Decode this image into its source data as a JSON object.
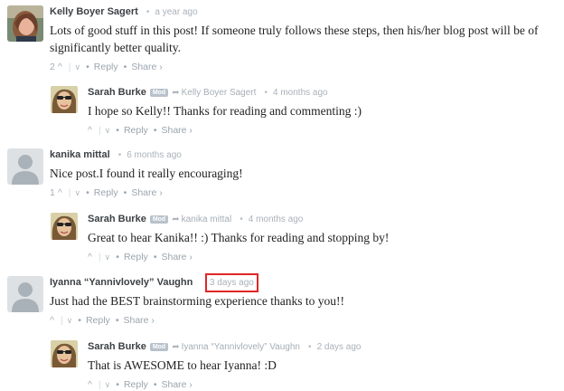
{
  "comments": [
    {
      "author": "Kelly Boyer Sagert",
      "time": "a year ago",
      "text": "Lots of good stuff in this post! If someone truly follows these steps, then his/her blog post will be of significantly better quality.",
      "votes": "2",
      "reply_label": "Reply",
      "share_label": "Share ›"
    },
    {
      "author": "Sarah Burke",
      "badge": "Mod",
      "in_reply_to": "Kelly Boyer Sagert",
      "time": "4 months ago",
      "text": "I hope so Kelly!! Thanks for reading and commenting :)",
      "reply_label": "Reply",
      "share_label": "Share ›"
    },
    {
      "author": "kanika mittal",
      "time": "6 months ago",
      "text": "Nice post.I found it really encouraging!",
      "votes": "1",
      "reply_label": "Reply",
      "share_label": "Share ›"
    },
    {
      "author": "Sarah Burke",
      "badge": "Mod",
      "in_reply_to": "kanika mittal",
      "time": "4 months ago",
      "text": "Great to hear Kanika!! :) Thanks for reading and stopping by!",
      "reply_label": "Reply",
      "share_label": "Share ›"
    },
    {
      "author": "Iyanna “Yannivlovely” Vaughn",
      "time": "3 days ago",
      "text": "Just had the BEST brainstorming experience thanks to you!!",
      "reply_label": "Reply",
      "share_label": "Share ›"
    },
    {
      "author": "Sarah Burke",
      "badge": "Mod",
      "in_reply_to": "Iyanna “Yannivlovely” Vaughn",
      "time": "2 days ago",
      "text": "That is AWESOME to hear Iyanna! :D",
      "reply_label": "Reply",
      "share_label": "Share ›"
    }
  ],
  "colors": {
    "highlight_box": "#e12626",
    "author": "#3c4145",
    "meta": "#9aa5ae"
  }
}
